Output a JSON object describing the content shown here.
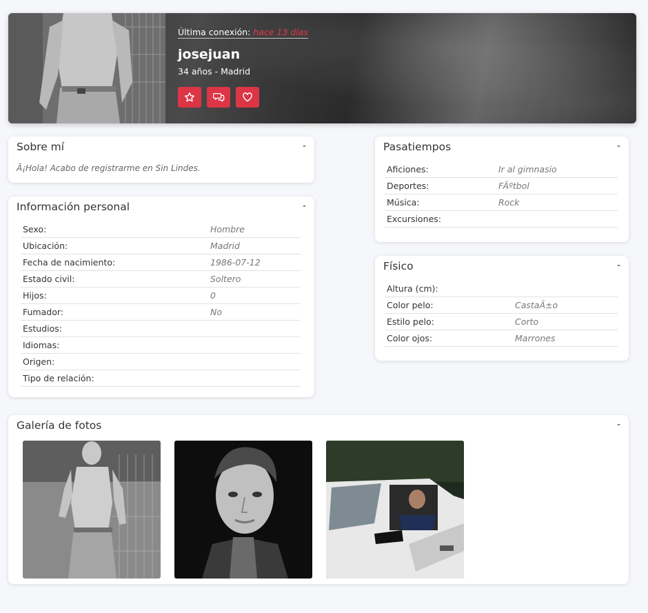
{
  "profile": {
    "last_connection_label": "Última conexión:",
    "last_connection_value": "hace 13 días",
    "username": "josejuan",
    "subline": "34 años - Madrid",
    "actions": [
      "star-icon",
      "chat-icon",
      "heart-icon"
    ]
  },
  "about": {
    "title": "Sobre mí",
    "toggle": "-",
    "text": "Â¡Hola! Acabo de registrarme en Sin Lindes."
  },
  "personal": {
    "title": "Información personal",
    "toggle": "-",
    "rows": [
      {
        "label": "Sexo:",
        "value": "Hombre"
      },
      {
        "label": "Ubicación:",
        "value": "Madrid"
      },
      {
        "label": "Fecha de nacimiento:",
        "value": "1986-07-12"
      },
      {
        "label": "Estado civil:",
        "value": "Soltero"
      },
      {
        "label": "Hijos:",
        "value": "0"
      },
      {
        "label": "Fumador:",
        "value": "No"
      },
      {
        "label": "Estudios:",
        "value": ""
      },
      {
        "label": "Idiomas:",
        "value": ""
      },
      {
        "label": "Origen:",
        "value": ""
      },
      {
        "label": "Tipo de relación:",
        "value": ""
      }
    ]
  },
  "hobbies": {
    "title": "Pasatiempos",
    "toggle": "-",
    "rows": [
      {
        "label": "Aficiones:",
        "value": "Ir al gimnasio"
      },
      {
        "label": "Deportes:",
        "value": "FÃºtbol"
      },
      {
        "label": "Música:",
        "value": "Rock"
      },
      {
        "label": "Excursiones:",
        "value": ""
      }
    ]
  },
  "physical": {
    "title": "Físico",
    "toggle": "-",
    "rows": [
      {
        "label": "Altura (cm):",
        "value": ""
      },
      {
        "label": "Color pelo:",
        "value": "CastaÃ±o"
      },
      {
        "label": "Estilo pelo:",
        "value": "Corto"
      },
      {
        "label": "Color ojos:",
        "value": "Marrones"
      }
    ]
  },
  "gallery": {
    "title": "Galería de fotos",
    "toggle": "-",
    "photos": [
      "gallery-photo-gym",
      "gallery-photo-portrait",
      "gallery-photo-truck"
    ]
  },
  "colors": {
    "accent": "#dc3545",
    "page_bg": "#f6f7fa",
    "label": "#333333",
    "value": "#777777"
  }
}
